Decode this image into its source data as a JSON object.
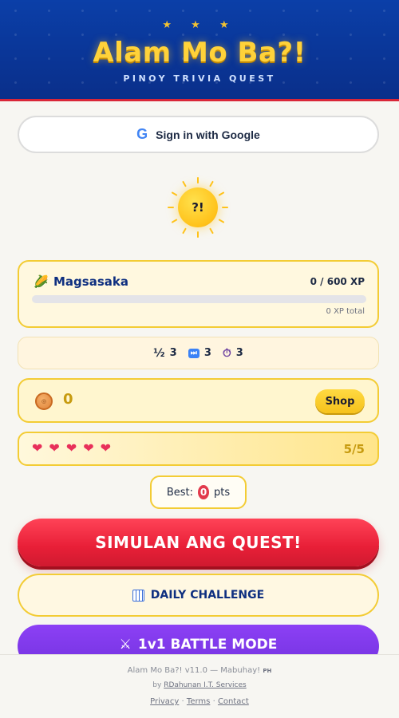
{
  "header": {
    "stars": "★ ★ ★",
    "title": "Alam Mo Ba?!",
    "subtitle": "PINOY TRIVIA QUEST",
    "colors": {
      "background": "#0b3fa8",
      "title": "#ffd23a",
      "accent_line": "#d92638"
    }
  },
  "auth": {
    "google_label": "Sign in with Google",
    "google_icon": "G"
  },
  "mascot": {
    "text": "?!",
    "icon": "sun-icon"
  },
  "rank": {
    "icon": "corn-icon",
    "icon_glyph": "🌽",
    "name": "Magsasaka",
    "xp_text": "0 / 600 XP",
    "xp_progress": 0,
    "total_text": "0 XP total"
  },
  "powerups": [
    {
      "icon": "half-icon",
      "glyph": "½",
      "count": "3"
    },
    {
      "icon": "fast-forward-icon",
      "glyph": "⏭",
      "count": "3"
    },
    {
      "icon": "timer-icon",
      "glyph": "⏱",
      "count": "3"
    }
  ],
  "coins": {
    "icon": "coin-icon",
    "count": "0",
    "shop_label": "Shop"
  },
  "lives": {
    "heart_glyph": "❤",
    "hearts": 5,
    "count_text": "5/5",
    "color": "#e8305a"
  },
  "best": {
    "label": "Best:",
    "value": "0",
    "unit": "pts"
  },
  "buttons": {
    "start": "SIMULAN ANG QUEST!",
    "daily": "DAILY CHALLENGE",
    "battle": "1v1 BATTLE MODE",
    "battle_icon_glyph": "⚔"
  },
  "footer": {
    "version": "Alam Mo Ba?! v11.0 — Mabuhay!",
    "flag": "PH",
    "by_prefix": "by",
    "author": "RDahunan I.T. Services",
    "links": [
      "Privacy",
      "Terms",
      "Contact"
    ],
    "separator": "·"
  }
}
